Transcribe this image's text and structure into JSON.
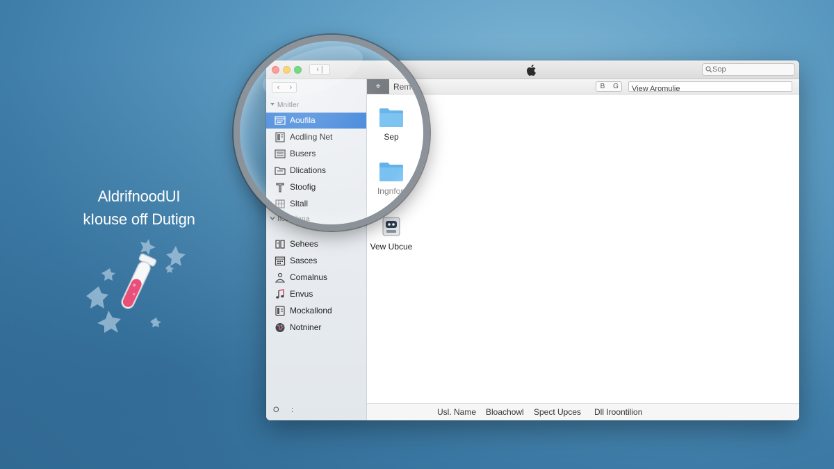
{
  "tagline": {
    "line1": "AldrifnoodUI",
    "line2": "kIouse off Dutign"
  },
  "window": {
    "titlebar": {
      "back_label": "‹ |",
      "search_placeholder": "Sop"
    },
    "sidebar": {
      "nav_back": "‹",
      "nav_forward": "›",
      "section1": "Mnitler",
      "section1_icon": "triangle-down-icon",
      "items1": [
        {
          "label": "Aoufila",
          "icon": "app-window-icon",
          "selected": true
        },
        {
          "label": "Acdling Net",
          "icon": "document-icon"
        },
        {
          "label": "Busers",
          "icon": "list-icon"
        },
        {
          "label": "Dlications",
          "icon": "folder-icon"
        },
        {
          "label": "Stoofig",
          "icon": "hammer-icon"
        },
        {
          "label": "Sltall",
          "icon": "grid-icon"
        }
      ],
      "section2": "Ilociallana",
      "items2": [
        {
          "label": "Sehees",
          "icon": "book-icon"
        },
        {
          "label": "Sasces",
          "icon": "calendar-icon"
        },
        {
          "label": "Comalnus",
          "icon": "people-icon"
        },
        {
          "label": "Envus",
          "icon": "music-icon"
        },
        {
          "label": "Mockallond",
          "icon": "document-icon"
        },
        {
          "label": "Notniner",
          "icon": "globe-icon"
        }
      ],
      "footer_symbol": "O",
      "footer_colon": ":"
    },
    "toolbar": {
      "action_symbol": "⌖",
      "title": "Rem",
      "toggle_a": "B",
      "toggle_b": "G",
      "view_value": "View Aromulie"
    },
    "files": [
      {
        "label": "Sep",
        "icon": "folder-icon"
      },
      {
        "label": "Ingnfon",
        "icon": "folder-icon"
      },
      {
        "label": "Vew Ubcue",
        "icon": "robot-app-icon"
      }
    ],
    "status_columns": [
      "Usl. Name",
      "Bloachowl",
      "Spect Upces",
      "Dll Iroontilion"
    ]
  },
  "colors": {
    "selection": "#3d83d9",
    "background": "#4a8bb5",
    "accent_pink": "#e8507a"
  }
}
